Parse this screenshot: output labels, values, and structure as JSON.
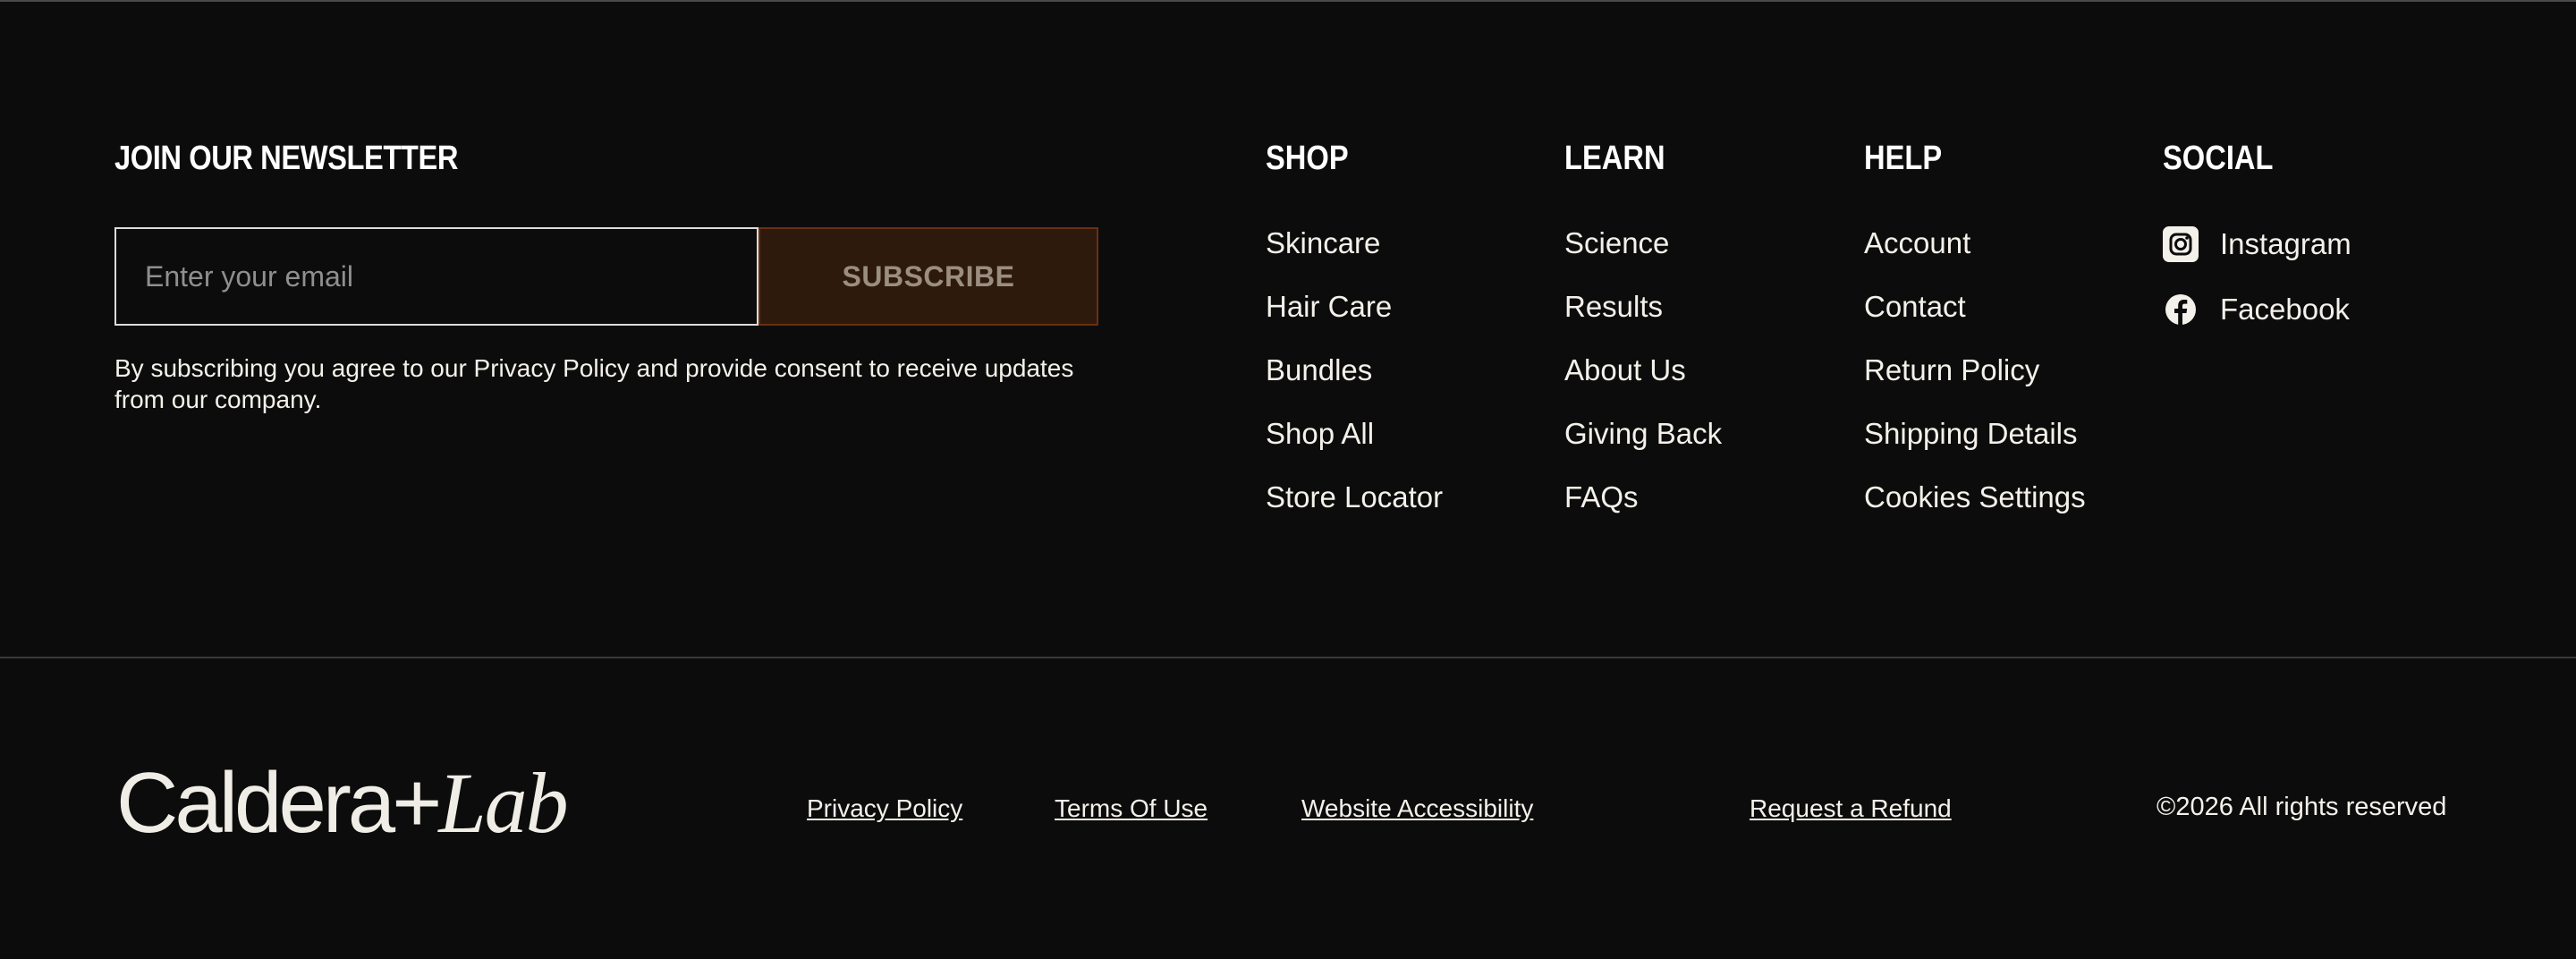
{
  "newsletter": {
    "title": "JOIN OUR NEWSLETTER",
    "email_placeholder": "Enter your email",
    "subscribe_label": "SUBSCRIBE",
    "consent_text": "By subscribing you agree to our Privacy Policy and provide consent to receive updates from our company."
  },
  "columns": {
    "shop": {
      "title": "SHOP",
      "items": [
        "Skincare",
        "Hair Care",
        "Bundles",
        "Shop All",
        "Store Locator"
      ]
    },
    "learn": {
      "title": "LEARN",
      "items": [
        "Science",
        "Results",
        "About Us",
        "Giving Back",
        "FAQs"
      ]
    },
    "help": {
      "title": "HELP",
      "items": [
        "Account",
        "Contact",
        "Return Policy",
        "Shipping Details",
        "Cookies Settings"
      ]
    },
    "social": {
      "title": "SOCIAL",
      "items": [
        {
          "label": "Instagram",
          "icon": "instagram-icon"
        },
        {
          "label": "Facebook",
          "icon": "facebook-icon"
        }
      ]
    }
  },
  "footer": {
    "logo": {
      "main": "Caldera+",
      "italic": "Lab"
    },
    "links": [
      "Privacy Policy",
      "Terms Of Use",
      "Website Accessibility",
      "Request a Refund"
    ],
    "copyright": "©2026 All rights reserved"
  },
  "colors": {
    "background": "#0c0c0c",
    "text": "#f4f1ea",
    "subscribe_bg": "#2e190d",
    "subscribe_border": "#6b2f11",
    "subscribe_text": "#9a8e80"
  }
}
